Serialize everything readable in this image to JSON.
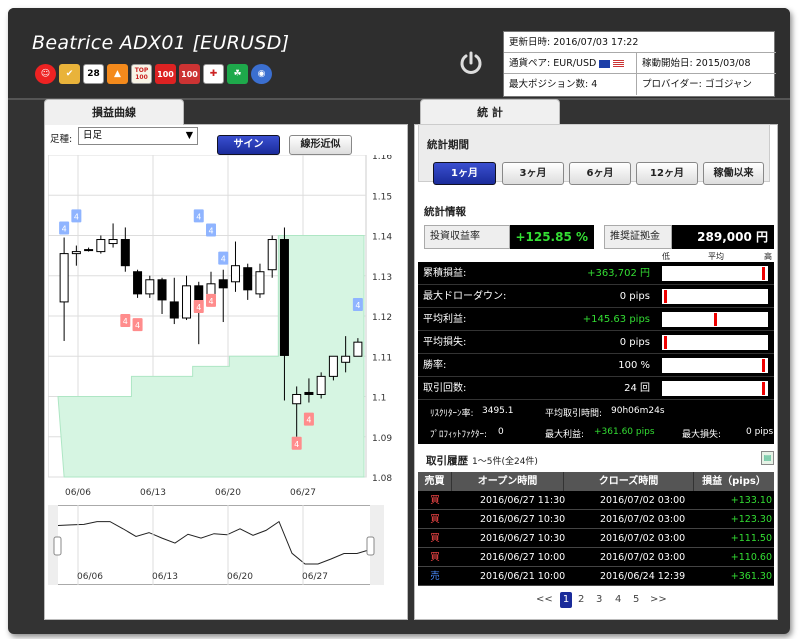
{
  "header": {
    "title": "Beatrice ADX01 [EURUSD]",
    "icons": [
      "smile-icon",
      "ok-icon",
      "28-icon",
      "flame-icon",
      "top100-icon",
      "100-icon",
      "t100-icon",
      "flag-icon",
      "clover-icon",
      "globe-icon"
    ],
    "icon_texts": {
      "28": "28",
      "top100": "TOP 100",
      "100": "100",
      "t100": "100"
    }
  },
  "info": {
    "updated_label": "更新日時:",
    "updated": "2016/07/03 17:22",
    "pair_label": "通貨ペア:",
    "pair": "EUR/USD",
    "start_label": "稼動開始日:",
    "start": "2015/03/08",
    "maxpos_label": "最大ポジション数:",
    "maxpos": "4",
    "provider_label": "プロバイダー:",
    "provider": "ゴゴジャン"
  },
  "left": {
    "tab": "損益曲線",
    "ashi_label": "足種:",
    "ashi_value": "日足",
    "sign_btn": "サイン",
    "linear_btn": "線形近似",
    "y_ticks": [
      "1.16",
      "1.15",
      "1.14",
      "1.13",
      "1.12",
      "1.11",
      "1.1",
      "1.09",
      "1.08"
    ],
    "x_ticks": [
      "06/06",
      "06/13",
      "06/20",
      "06/27"
    ],
    "nav_ticks": [
      "06/06",
      "06/13",
      "06/20",
      "06/27"
    ]
  },
  "right": {
    "tab": "統 計",
    "period_label": "統計期間",
    "periods": [
      "1ヶ月",
      "3ヶ月",
      "6ヶ月",
      "12ヶ月",
      "稼働以来"
    ],
    "info_title": "統計情報",
    "roi_label": "投資収益率",
    "roi": "+125.85 %",
    "margin_label": "推奨証拠金",
    "margin": "289,000 円",
    "gauge_head": [
      "低",
      "平均",
      "高"
    ],
    "stats": [
      {
        "label": "累積損益:",
        "value": "+363,702 円",
        "green": true,
        "mark": 0.97
      },
      {
        "label": "最大ドローダウン:",
        "value": "0 pips",
        "green": false,
        "mark": 0.02
      },
      {
        "label": "平均利益:",
        "value": "+145.63 pips",
        "green": true,
        "mark": 0.5
      },
      {
        "label": "平均損失:",
        "value": "0 pips",
        "green": false,
        "mark": 0.02
      },
      {
        "label": "勝率:",
        "value": "100 %",
        "green": false,
        "mark": 0.97
      },
      {
        "label": "取引回数:",
        "value": "24 回",
        "green": false,
        "mark": 0.97
      }
    ],
    "rr_label": "ﾘｽｸﾘﾀｰﾝ率:",
    "rr": "3495.1",
    "avgtime_label": "平均取引時間:",
    "avgtime": "90h06m24s",
    "pf_label": "ﾌﾟﾛﾌｨｯﾄﾌｧｸﾀｰ:",
    "pf": "0",
    "maxprofit_label": "最大利益:",
    "maxprofit": "+361.60 pips",
    "maxloss_label": "最大損失:",
    "maxloss": "0 pips",
    "history_title": "取引履歴",
    "history_count": "1～5件(全24件)",
    "history_head": [
      "売買",
      "オープン時間",
      "クローズ時間",
      "損益（pips）"
    ],
    "history": [
      {
        "side": "買",
        "open": "2016/06/27 11:30",
        "close": "2016/07/02 03:00",
        "pips": "+133.10"
      },
      {
        "side": "買",
        "open": "2016/06/27 10:30",
        "close": "2016/07/02 03:00",
        "pips": "+123.30"
      },
      {
        "side": "買",
        "open": "2016/06/27 10:30",
        "close": "2016/07/02 03:00",
        "pips": "+111.50"
      },
      {
        "side": "買",
        "open": "2016/06/27 10:00",
        "close": "2016/07/02 03:00",
        "pips": "+110.60"
      },
      {
        "side": "売",
        "open": "2016/06/21 10:00",
        "close": "2016/06/24 12:39",
        "pips": "+361.30"
      }
    ],
    "pager": {
      "prev": "<<",
      "pages": [
        "1",
        "2",
        "3",
        "4",
        "5"
      ],
      "next": ">>"
    }
  },
  "colors": {
    "buy": "#ff4a4a",
    "sell": "#4a8cff",
    "green": "#33dd33"
  },
  "chart_data": {
    "type": "candlestick",
    "ylim": [
      1.08,
      1.16
    ],
    "y_ticks": [
      1.16,
      1.15,
      1.14,
      1.13,
      1.12,
      1.11,
      1.1,
      1.09,
      1.08
    ],
    "x_ticks": [
      "06/06",
      "06/13",
      "06/20",
      "06/27"
    ],
    "candles": [
      [
        1.1235,
        1.1355,
        1.1138,
        1.1395
      ],
      [
        1.1355,
        1.136,
        1.1325,
        1.1375
      ],
      [
        1.1365,
        1.1365,
        1.136,
        1.137
      ],
      [
        1.136,
        1.139,
        1.1355,
        1.14
      ],
      [
        1.138,
        1.139,
        1.137,
        1.143
      ],
      [
        1.139,
        1.1325,
        1.131,
        1.142
      ],
      [
        1.131,
        1.1255,
        1.1245,
        1.1315
      ],
      [
        1.1255,
        1.129,
        1.1245,
        1.13
      ],
      [
        1.129,
        1.124,
        1.1205,
        1.1295
      ],
      [
        1.1235,
        1.1195,
        1.118,
        1.1295
      ],
      [
        1.1195,
        1.1275,
        1.119,
        1.13
      ],
      [
        1.1275,
        1.124,
        1.113,
        1.1285
      ],
      [
        1.124,
        1.128,
        1.123,
        1.131
      ],
      [
        1.129,
        1.127,
        1.1185,
        1.1315
      ],
      [
        1.1285,
        1.1325,
        1.126,
        1.1385
      ],
      [
        1.132,
        1.1265,
        1.124,
        1.133
      ],
      [
        1.1255,
        1.131,
        1.1245,
        1.133
      ],
      [
        1.1315,
        1.139,
        1.1295,
        1.14
      ],
      [
        1.139,
        1.1102,
        1.099,
        1.142
      ],
      [
        1.0982,
        1.1005,
        1.09,
        1.1025
      ],
      [
        1.101,
        1.1005,
        1.0985,
        1.1045
      ],
      [
        1.1005,
        1.105,
        1.0995,
        1.106
      ],
      [
        1.105,
        1.11,
        1.104,
        1.11
      ],
      [
        1.1085,
        1.11,
        1.106,
        1.115
      ],
      [
        1.11,
        1.1135,
        1.111,
        1.1145
      ]
    ],
    "equity": [
      1.1,
      1.1,
      1.1,
      1.1,
      1.1,
      1.1,
      1.105,
      1.105,
      1.105,
      1.105,
      1.105,
      1.1075,
      1.1075,
      1.1075,
      1.11,
      1.11,
      1.11,
      1.11,
      1.14,
      1.14,
      1.14,
      1.14,
      1.14,
      1.14,
      1.14
    ],
    "sell_signals": [
      [
        0,
        1.1415,
        "4"
      ],
      [
        1,
        1.1445,
        "4"
      ],
      [
        11,
        1.1445,
        "4"
      ],
      [
        12,
        1.141,
        "4"
      ],
      [
        13,
        1.134,
        "4"
      ],
      [
        24,
        1.1225,
        "4"
      ]
    ],
    "buy_signals": [
      [
        5,
        1.1185,
        "4"
      ],
      [
        6,
        1.1175,
        "4"
      ],
      [
        11,
        1.122,
        "4"
      ],
      [
        12,
        1.1235,
        "4"
      ],
      [
        20,
        1.094,
        "4"
      ],
      [
        19,
        1.088,
        "4"
      ]
    ]
  }
}
